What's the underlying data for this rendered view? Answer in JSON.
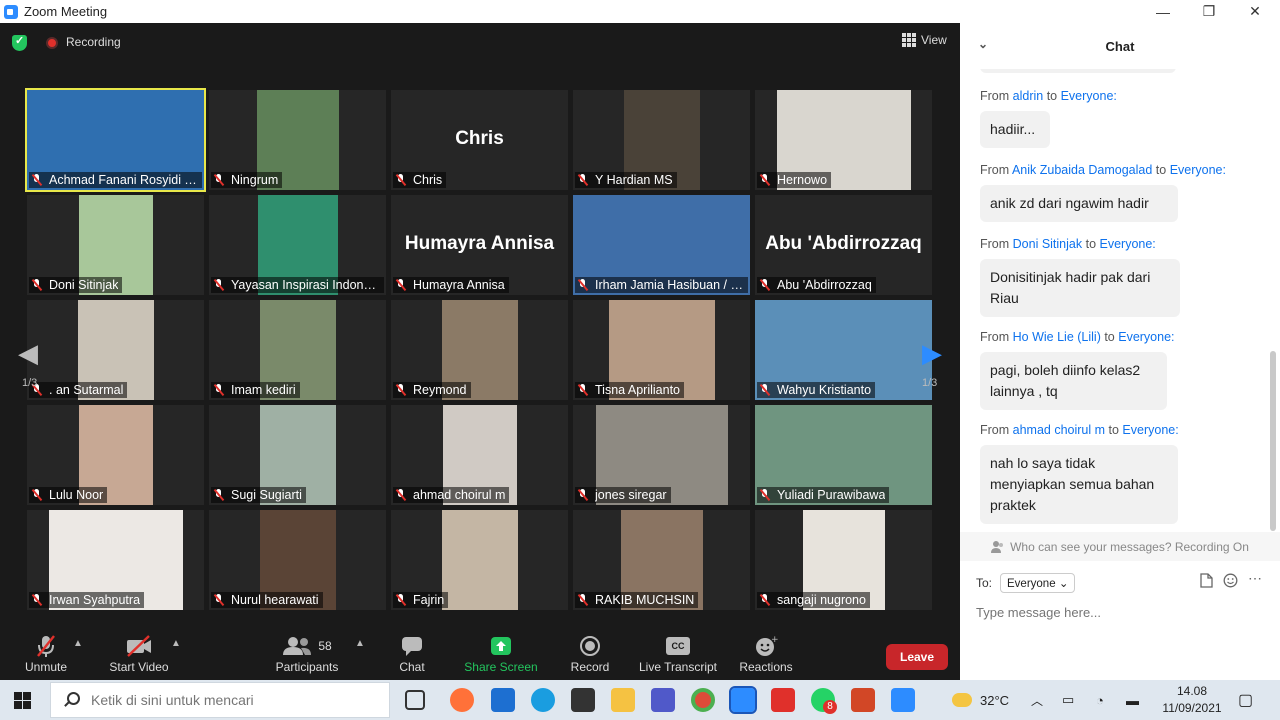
{
  "window": {
    "title": "Zoom Meeting",
    "controls": [
      "—",
      "❐",
      "✕"
    ]
  },
  "topbar": {
    "recording_label": "Recording",
    "view_label": "View"
  },
  "gallery": {
    "page": "1/3",
    "tiles": [
      {
        "name": "Achmad Fanani Rosyidi YI...",
        "big": "",
        "bg": "#2f6fb0",
        "active": true
      },
      {
        "name": "Ningrum",
        "big": "",
        "bg": "#5d7f56",
        "active": false
      },
      {
        "name": "Chris",
        "big": "Chris",
        "bg": "",
        "active": false
      },
      {
        "name": "Y Hardian MS",
        "big": "",
        "bg": "#4a4238",
        "active": false
      },
      {
        "name": "Hernowo",
        "big": "",
        "bg": "#d9d6cf",
        "active": false
      },
      {
        "name": "Doni Sitinjak",
        "big": "",
        "bg": "#a8c79a",
        "active": false
      },
      {
        "name": "Yayasan Inspirasi Indones...",
        "big": "",
        "bg": "#2f8f6e",
        "active": false
      },
      {
        "name": "Humayra Annisa",
        "big": "Humayra Annisa",
        "bg": "",
        "active": false
      },
      {
        "name": "Irham Jamia Hasibuan / P...",
        "big": "",
        "bg": "#3f6ea8",
        "active": false
      },
      {
        "name": "Abu 'Abdirrozzaq",
        "big": "Abu 'Abdirrozzaq",
        "bg": "",
        "active": false
      },
      {
        "name": ". an Sutarmal",
        "big": "",
        "bg": "#c9c2b6",
        "active": false
      },
      {
        "name": "Imam kediri",
        "big": "",
        "bg": "#7a8a6a",
        "active": false
      },
      {
        "name": "Reymond",
        "big": "",
        "bg": "#8b7a66",
        "active": false
      },
      {
        "name": "Tisna Aprilianto",
        "big": "",
        "bg": "#b59a84",
        "active": false
      },
      {
        "name": "Wahyu Kristianto",
        "big": "",
        "bg": "#5b8fb8",
        "active": false
      },
      {
        "name": "Lulu Noor",
        "big": "",
        "bg": "#c7a894",
        "active": false
      },
      {
        "name": "Sugi Sugiarti",
        "big": "",
        "bg": "#9fb0a4",
        "active": false
      },
      {
        "name": "ahmad choirul m",
        "big": "",
        "bg": "#d0cac4",
        "active": false
      },
      {
        "name": "jones siregar",
        "big": "",
        "bg": "#8e8a82",
        "active": false
      },
      {
        "name": "Yuliadi Purawibawa",
        "big": "",
        "bg": "#6f9580",
        "active": false
      },
      {
        "name": "Irwan Syahputra",
        "big": "",
        "bg": "#ece8e4",
        "active": false
      },
      {
        "name": "Nurul hearawati",
        "big": "",
        "bg": "#5a4436",
        "active": false
      },
      {
        "name": "Fajrin",
        "big": "",
        "bg": "#c4b6a4",
        "active": false
      },
      {
        "name": "RAKIB MUCHSIN",
        "big": "",
        "bg": "#8a7462",
        "active": false
      },
      {
        "name": "sangaji nugrono",
        "big": "",
        "bg": "#e7e3dc",
        "active": false
      }
    ]
  },
  "toolbar": {
    "unmute": "Unmute",
    "start_video": "Start Video",
    "participants": "Participants",
    "participants_count": "58",
    "chat": "Chat",
    "share_screen": "Share Screen",
    "record": "Record",
    "live_transcript": "Live Transcript",
    "reactions": "Reactions",
    "leave": "Leave",
    "cc": "CC"
  },
  "chat": {
    "title": "Chat",
    "messages": [
      {
        "from": "aldrin",
        "to": "Everyone",
        "text": "hadiir..."
      },
      {
        "from": "Anik Zubaida Damogalad",
        "to": "Everyone",
        "text": "anik zd dari ngawim hadir"
      },
      {
        "from": "Doni Sitinjak",
        "to": "Everyone",
        "text": "Donisitinjak hadir pak dari Riau"
      },
      {
        "from": "Ho Wie Lie (Lili)",
        "to": "Everyone",
        "text": "pagi, boleh diinfo kelas2 lainnya , tq"
      },
      {
        "from": "ahmad choirul m",
        "to": "Everyone",
        "text": "nah lo saya tidak menyiapkan semua bahan praktek"
      }
    ],
    "from_word": "From",
    "to_word": "to",
    "who_can_see": "Who can see your messages? Recording On",
    "to_label": "To:",
    "recipient": "Everyone",
    "input_placeholder": "Type message here..."
  },
  "taskbar": {
    "search_placeholder": "Ketik di sini untuk mencari",
    "temperature": "32°C",
    "time": "14.08",
    "date": "11/09/2021",
    "whatsapp_badge": "8"
  },
  "colors": {
    "accent": "#0e72ed",
    "leave": "#c8262a",
    "share": "#23c55e",
    "active_speaker": "#e8e84a"
  }
}
